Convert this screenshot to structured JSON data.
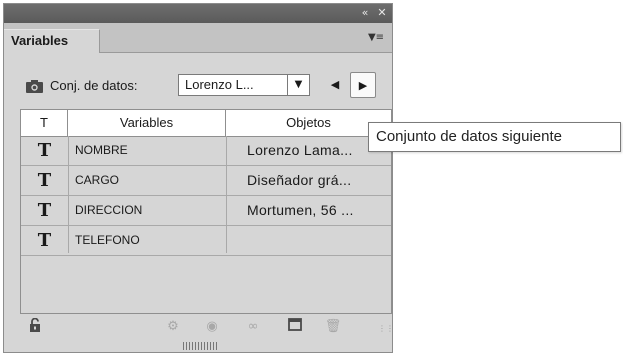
{
  "panel": {
    "collapse_icon": "double-chevron-icon",
    "close_icon": "close-icon",
    "tab_label": "Variables",
    "menu_icon": "panel-menu-icon"
  },
  "dataset": {
    "label": "Conj. de datos:",
    "selected": "Lorenzo L...",
    "camera_icon": "camera-icon"
  },
  "table": {
    "headers": [
      "T",
      "Variables",
      "Objetos"
    ],
    "rows": [
      {
        "type": "T",
        "variable": "NOMBRE",
        "object": "Lorenzo Lama..."
      },
      {
        "type": "T",
        "variable": "CARGO",
        "object": "Diseñador grá..."
      },
      {
        "type": "T",
        "variable": "DIRECCION",
        "object": "Mortumen, 56 ..."
      },
      {
        "type": "T",
        "variable": "TELEFONO",
        "object": ""
      }
    ]
  },
  "footer": {
    "icons": [
      "lock-icon",
      "bind-icon",
      "visibility-icon",
      "unbind-icon",
      "new-variable-icon",
      "trash-icon"
    ]
  },
  "tooltip": {
    "text": "Conjunto de datos siguiente"
  }
}
